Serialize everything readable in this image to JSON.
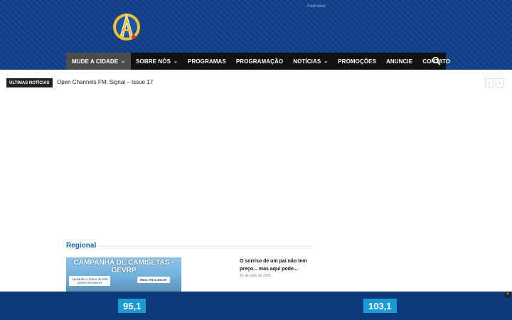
{
  "header": {
    "logo_icon": "tower-a-logo-icon",
    "ad_label": "Publicidade"
  },
  "nav": {
    "items": [
      {
        "label": "MUDE A CIDADE",
        "dropdown": true,
        "active": true
      },
      {
        "label": "SOBRE NÓS",
        "dropdown": true
      },
      {
        "label": "PROGRAMAS",
        "dropdown": false
      },
      {
        "label": "PROGRAMAÇÃO",
        "dropdown": false
      },
      {
        "label": "NOTÍCIAS",
        "dropdown": true
      },
      {
        "label": "PROMOÇÕES",
        "dropdown": false
      },
      {
        "label": "ANUNCIE",
        "dropdown": false
      },
      {
        "label": "CONTATO",
        "dropdown": false
      }
    ],
    "search_icon": "search-icon"
  },
  "ticker": {
    "tag": "ÚLTIMAS NOTÍCIAS",
    "headline": "Open Channels FM: Signal – Issue 17",
    "prev_icon": "chevron-left-icon",
    "next_icon": "chevron-right-icon"
  },
  "regional": {
    "title": "Regional",
    "featured": {
      "image_title": "CAMPANHA DE CAMISETAS - GEVRP",
      "image_subtitle": "Apoiando o futuro de 220 jovens escoteiros",
      "image_goal": "Meta: R$ 1.100,00"
    },
    "article": {
      "title": "O sorriso de um pai não tem preço... mas aqui pode...",
      "date": "14 de julho de 2025"
    }
  },
  "radio_bar": {
    "freq_1": "95,1",
    "freq_2": "103,1",
    "close_label": "×"
  },
  "colors": {
    "header_blue": "#123f8a",
    "nav_black": "#111111",
    "section_blue": "#1c66b8",
    "freq_cyan": "#1a9ad6"
  }
}
